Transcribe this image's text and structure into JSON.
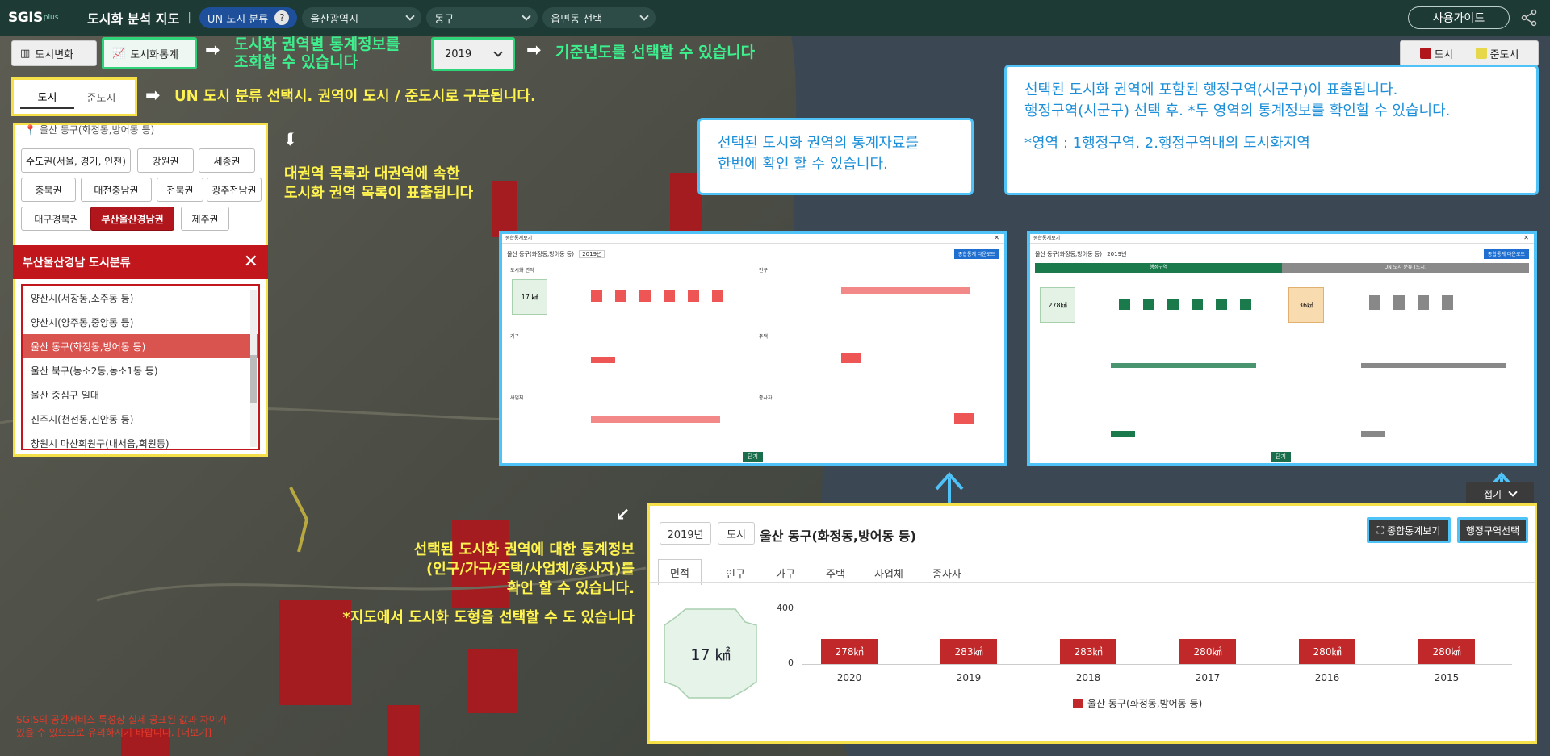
{
  "header": {
    "logo": "SGIS",
    "logo_plus": "plus",
    "title": "도시화 분석 지도",
    "un_pill": "UN 도시 분류",
    "help": "?",
    "sido": "울산광역시",
    "sgg": "동구",
    "emd": "읍면동 선택",
    "guide": "사용가이드"
  },
  "toolbar": {
    "change": "도시변화",
    "stats": "도시화통계",
    "year": "2019",
    "legend_city": "도시",
    "legend_semi": "준도시"
  },
  "notes": {
    "stats_1": "도시화 권역별 통계정보를",
    "stats_2": "조회할 수 있습니다",
    "year": "기준년도를 선택할 수 있습니다",
    "un": "UN 도시 분류 선택시. 권역이 도시 / 준도시로 구분됩니다.",
    "region_1": "대권역 목록과 대권역에 속한",
    "region_2": "도시화 권역 목록이 표출됩니다",
    "bottom_1": "선택된 도시화 권역에 대한 통계정보",
    "bottom_2": "(인구/가구/주택/사업체/종사자)를",
    "bottom_3": "확인 할 수 있습니다.",
    "bottom_4": "*지도에서 도시화 도형을 선택할 수 도 있습니다"
  },
  "callouts": {
    "a_1": "선택된 도시화 권역의 통계자료를",
    "a_2": "한번에 확인 할 수 있습니다.",
    "b_1": "선택된 도시화 권역에 포함된 행정구역(시군구)이 표출됩니다.",
    "b_2": "행정구역(시군구) 선택 후. *두 영역의 통계정보를 확인할 수 있습니다.",
    "b_3": "*영역 : 1행정구역. 2.행정구역내의 도시화지역"
  },
  "toggle": {
    "city": "도시",
    "semi": "준도시"
  },
  "left": {
    "location": "울산 동구(화정동,방어동 등)",
    "regions": [
      "수도권(서울, 경기, 인천)",
      "강원권",
      "세종권",
      "충북권",
      "대전충남권",
      "전북권",
      "광주전남권",
      "대구경북권",
      "부산울산경남권",
      "제주권"
    ],
    "class_title": "부산울산경남 도시분류",
    "list": [
      "양산시(서창동,소주동 등)",
      "양산시(양주동,중앙동 등)",
      "울산 동구(화정동,방어동 등)",
      "울산 북구(농소2동,농소1동 등)",
      "울산 중심구 일대",
      "진주시(천전동,신안동 등)",
      "창원시 마산회원구(내서읍,회원동)"
    ]
  },
  "mini_a": {
    "title": "종합통계보기",
    "subject": "울산 동구(화정동,방어동 등)",
    "year": "2019년",
    "download": "종합통계 다운로드",
    "area_value": "17 ㎢",
    "close": "닫기",
    "sections": [
      "도시화 면적",
      "인구",
      "가구",
      "주택",
      "사업체",
      "종사자"
    ]
  },
  "mini_b": {
    "title": "종합통계보기",
    "subject": "울산 동구(화정동,방어동 등)",
    "year": "2019년",
    "download": "종합통계 다운로드",
    "tab_admin": "행정구역",
    "tab_un": "UN 도시 분류 (도시)",
    "area_a": "278㎢",
    "area_b": "36㎢",
    "close": "닫기"
  },
  "collapse": "접기",
  "stat_panel": {
    "year": "2019년",
    "type": "도시",
    "subject": "울산 동구(화정동,방어동 등)",
    "summary_btn": "종합통계보기",
    "admin_btn": "행정구역선택",
    "tabs": [
      "면적",
      "인구",
      "가구",
      "주택",
      "사업체",
      "종사자"
    ],
    "area_label": "17 ㎢",
    "legend": "울산 동구(화정동,방어동 등)"
  },
  "chart_data": {
    "type": "bar",
    "categories": [
      "2020",
      "2019",
      "2018",
      "2017",
      "2016",
      "2015"
    ],
    "values": [
      278,
      283,
      283,
      280,
      280,
      280
    ],
    "data_labels": [
      "278㎢",
      "283㎢",
      "283㎢",
      "280㎢",
      "280㎢",
      "280㎢"
    ],
    "y_ticks": [
      "400",
      "0"
    ],
    "ylim": [
      0,
      400
    ]
  },
  "footnote": {
    "line1": "SGIS의 공간서비스 특성상 실제 공표된 값과 차이가",
    "line2": "있을 수 있으므로 유의하시기 바랍니다. [더보기]"
  },
  "colors": {
    "accent_red": "#c0161c",
    "highlight_green": "#2fd47a",
    "highlight_yellow": "#f5e04a",
    "highlight_blue": "#4fc3f7"
  }
}
